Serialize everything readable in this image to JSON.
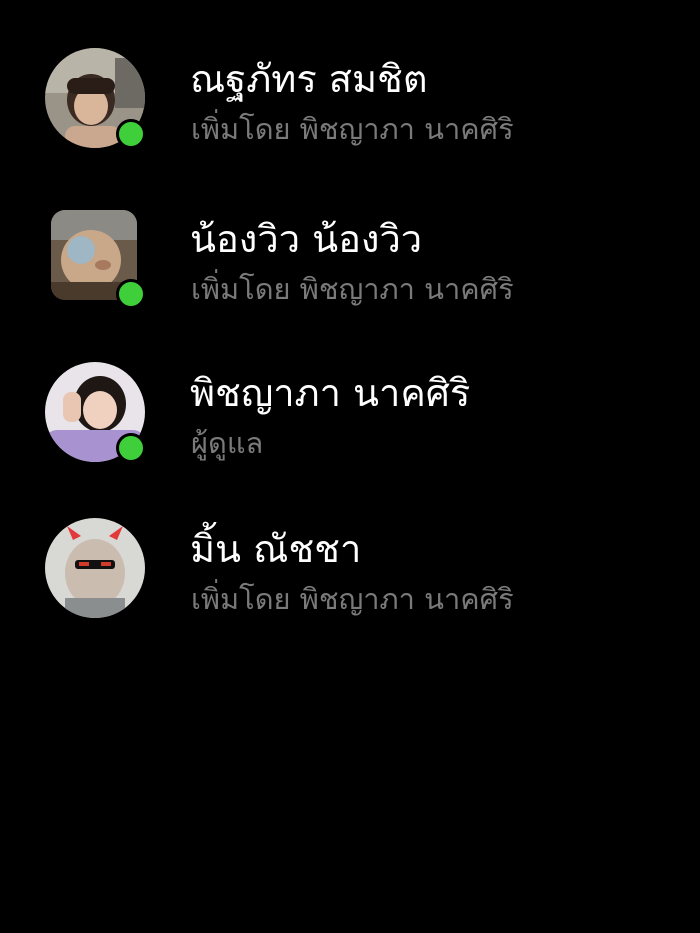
{
  "colors": {
    "background": "#000000",
    "name_text": "#ffffff",
    "subtitle_text": "#7a7a7a",
    "online_indicator": "#3fcf3a"
  },
  "members": [
    {
      "name": "ณฐภัทร สมชิต",
      "subtitle": "เพิ่มโดย พิชญาภา นาคศิริ",
      "online": true,
      "avatar_icon": "profile-photo"
    },
    {
      "name": "น้องวิว น้องวิว",
      "subtitle": "เพิ่มโดย พิชญาภา นาคศิริ",
      "online": true,
      "avatar_icon": "profile-photo"
    },
    {
      "name": "พิชญาภา นาคศิริ",
      "subtitle": "ผู้ดูแล",
      "online": true,
      "avatar_icon": "profile-photo"
    },
    {
      "name": "มิ้น ณัชชา",
      "subtitle": "เพิ่มโดย พิชญาภา นาคศิริ",
      "online": false,
      "avatar_icon": "profile-photo"
    }
  ]
}
